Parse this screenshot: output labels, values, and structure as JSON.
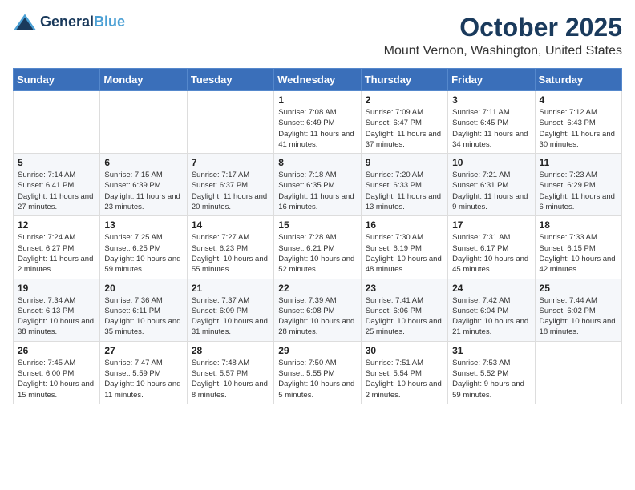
{
  "logo": {
    "line1": "General",
    "line2": "Blue"
  },
  "header": {
    "month": "October 2025",
    "location": "Mount Vernon, Washington, United States"
  },
  "weekdays": [
    "Sunday",
    "Monday",
    "Tuesday",
    "Wednesday",
    "Thursday",
    "Friday",
    "Saturday"
  ],
  "weeks": [
    [
      {
        "day": "",
        "content": ""
      },
      {
        "day": "",
        "content": ""
      },
      {
        "day": "",
        "content": ""
      },
      {
        "day": "1",
        "content": "Sunrise: 7:08 AM\nSunset: 6:49 PM\nDaylight: 11 hours and 41 minutes."
      },
      {
        "day": "2",
        "content": "Sunrise: 7:09 AM\nSunset: 6:47 PM\nDaylight: 11 hours and 37 minutes."
      },
      {
        "day": "3",
        "content": "Sunrise: 7:11 AM\nSunset: 6:45 PM\nDaylight: 11 hours and 34 minutes."
      },
      {
        "day": "4",
        "content": "Sunrise: 7:12 AM\nSunset: 6:43 PM\nDaylight: 11 hours and 30 minutes."
      }
    ],
    [
      {
        "day": "5",
        "content": "Sunrise: 7:14 AM\nSunset: 6:41 PM\nDaylight: 11 hours and 27 minutes."
      },
      {
        "day": "6",
        "content": "Sunrise: 7:15 AM\nSunset: 6:39 PM\nDaylight: 11 hours and 23 minutes."
      },
      {
        "day": "7",
        "content": "Sunrise: 7:17 AM\nSunset: 6:37 PM\nDaylight: 11 hours and 20 minutes."
      },
      {
        "day": "8",
        "content": "Sunrise: 7:18 AM\nSunset: 6:35 PM\nDaylight: 11 hours and 16 minutes."
      },
      {
        "day": "9",
        "content": "Sunrise: 7:20 AM\nSunset: 6:33 PM\nDaylight: 11 hours and 13 minutes."
      },
      {
        "day": "10",
        "content": "Sunrise: 7:21 AM\nSunset: 6:31 PM\nDaylight: 11 hours and 9 minutes."
      },
      {
        "day": "11",
        "content": "Sunrise: 7:23 AM\nSunset: 6:29 PM\nDaylight: 11 hours and 6 minutes."
      }
    ],
    [
      {
        "day": "12",
        "content": "Sunrise: 7:24 AM\nSunset: 6:27 PM\nDaylight: 11 hours and 2 minutes."
      },
      {
        "day": "13",
        "content": "Sunrise: 7:25 AM\nSunset: 6:25 PM\nDaylight: 10 hours and 59 minutes."
      },
      {
        "day": "14",
        "content": "Sunrise: 7:27 AM\nSunset: 6:23 PM\nDaylight: 10 hours and 55 minutes."
      },
      {
        "day": "15",
        "content": "Sunrise: 7:28 AM\nSunset: 6:21 PM\nDaylight: 10 hours and 52 minutes."
      },
      {
        "day": "16",
        "content": "Sunrise: 7:30 AM\nSunset: 6:19 PM\nDaylight: 10 hours and 48 minutes."
      },
      {
        "day": "17",
        "content": "Sunrise: 7:31 AM\nSunset: 6:17 PM\nDaylight: 10 hours and 45 minutes."
      },
      {
        "day": "18",
        "content": "Sunrise: 7:33 AM\nSunset: 6:15 PM\nDaylight: 10 hours and 42 minutes."
      }
    ],
    [
      {
        "day": "19",
        "content": "Sunrise: 7:34 AM\nSunset: 6:13 PM\nDaylight: 10 hours and 38 minutes."
      },
      {
        "day": "20",
        "content": "Sunrise: 7:36 AM\nSunset: 6:11 PM\nDaylight: 10 hours and 35 minutes."
      },
      {
        "day": "21",
        "content": "Sunrise: 7:37 AM\nSunset: 6:09 PM\nDaylight: 10 hours and 31 minutes."
      },
      {
        "day": "22",
        "content": "Sunrise: 7:39 AM\nSunset: 6:08 PM\nDaylight: 10 hours and 28 minutes."
      },
      {
        "day": "23",
        "content": "Sunrise: 7:41 AM\nSunset: 6:06 PM\nDaylight: 10 hours and 25 minutes."
      },
      {
        "day": "24",
        "content": "Sunrise: 7:42 AM\nSunset: 6:04 PM\nDaylight: 10 hours and 21 minutes."
      },
      {
        "day": "25",
        "content": "Sunrise: 7:44 AM\nSunset: 6:02 PM\nDaylight: 10 hours and 18 minutes."
      }
    ],
    [
      {
        "day": "26",
        "content": "Sunrise: 7:45 AM\nSunset: 6:00 PM\nDaylight: 10 hours and 15 minutes."
      },
      {
        "day": "27",
        "content": "Sunrise: 7:47 AM\nSunset: 5:59 PM\nDaylight: 10 hours and 11 minutes."
      },
      {
        "day": "28",
        "content": "Sunrise: 7:48 AM\nSunset: 5:57 PM\nDaylight: 10 hours and 8 minutes."
      },
      {
        "day": "29",
        "content": "Sunrise: 7:50 AM\nSunset: 5:55 PM\nDaylight: 10 hours and 5 minutes."
      },
      {
        "day": "30",
        "content": "Sunrise: 7:51 AM\nSunset: 5:54 PM\nDaylight: 10 hours and 2 minutes."
      },
      {
        "day": "31",
        "content": "Sunrise: 7:53 AM\nSunset: 5:52 PM\nDaylight: 9 hours and 59 minutes."
      },
      {
        "day": "",
        "content": ""
      }
    ]
  ]
}
